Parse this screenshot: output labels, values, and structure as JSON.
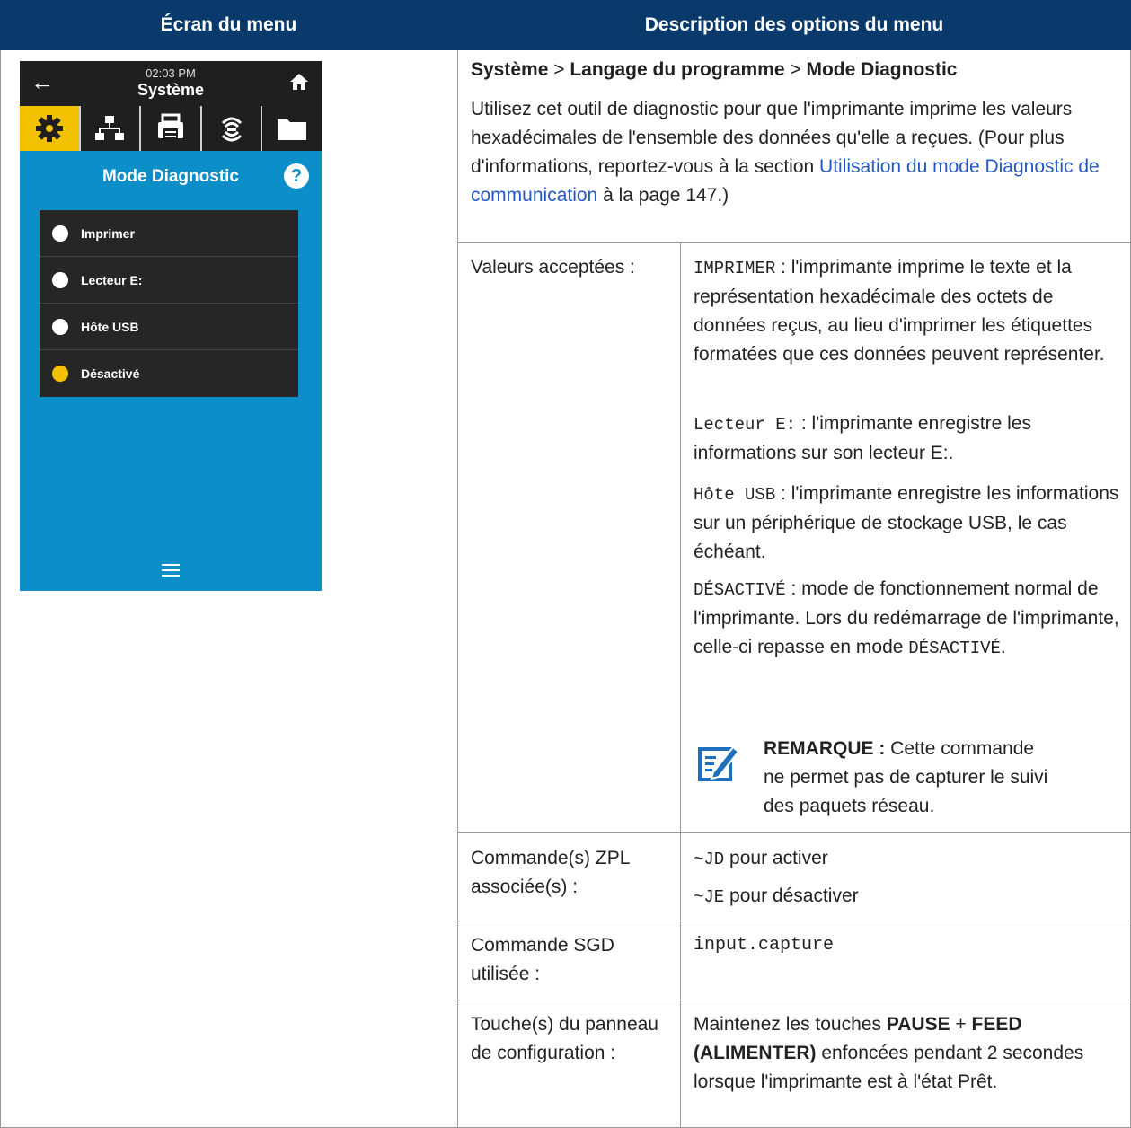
{
  "header": {
    "left": "Écran du menu",
    "right": "Description des options du menu"
  },
  "device": {
    "time": "02:03 PM",
    "title": "Système",
    "subtitle": "Mode Diagnostic",
    "help": "?",
    "items": [
      {
        "label": "Imprimer",
        "selected": false
      },
      {
        "label": "Lecteur E:",
        "selected": false
      },
      {
        "label": "Hôte USB",
        "selected": false
      },
      {
        "label": "Désactivé",
        "selected": true
      }
    ],
    "colors": {
      "background": "#0c8ec9",
      "accent": "#f2c200",
      "bar": "#1f1f1f"
    }
  },
  "breadcrumb": {
    "part1": "Système",
    "sep1": " > ",
    "part2": "Langage du programme",
    "sep2": " > ",
    "part3": "Mode Diagnostic"
  },
  "intro": {
    "text1": "Utilisez cet outil de diagnostic pour que l'imprimante imprime les valeurs hexadécimales de l'ensemble des données qu'elle a reçues. (Pour plus d'informations, reportez-vous à la section ",
    "link": "Utilisation du mode Diagnostic de communication",
    "text2": " à la page 147.)"
  },
  "rows": {
    "accepted": {
      "label": "Valeurs acceptées :",
      "imprimer_code": "IMPRIMER",
      "imprimer_text": " : l'imprimante imprime le texte et la représentation hexadécimale des octets de données reçus, au lieu d'imprimer les étiquettes formatées que ces données peuvent représenter.",
      "lecteur_code": "Lecteur E:",
      "lecteur_text": " : l'imprimante enregistre les informations sur son lecteur E:.",
      "usb_code": "Hôte USB",
      "usb_text": " : l'imprimante enregistre les informations sur un périphérique de stockage USB, le cas échéant.",
      "off_code": "DÉSACTIVÉ",
      "off_text1": " : mode de fonctionnement normal de l'imprimante. Lors du redémarrage de l'imprimante, celle-ci repasse en mode ",
      "off_code2": "DÉSACTIVÉ",
      "off_text2": ".",
      "note_label": "REMARQUE :",
      "note_text": " Cette commande ne permet pas de capturer le suivi des paquets réseau."
    },
    "zpl": {
      "label": "Commande(s) ZPL associée(s) :",
      "cmd1": "~JD",
      "cmd1_text": " pour activer",
      "cmd2": "~JE",
      "cmd2_text": " pour désactiver"
    },
    "sgd": {
      "label": "Commande SGD utilisée :",
      "cmd": "input.capture"
    },
    "keys": {
      "label": "Touche(s) du panneau de configuration :",
      "text1": "Maintenez les touches ",
      "key1": "PAUSE",
      "plus": " + ",
      "key2": "FEED (ALIMENTER)",
      "text2": " enfoncées pendant 2 secondes lorsque l'imprimante est à l'état Prêt."
    }
  }
}
